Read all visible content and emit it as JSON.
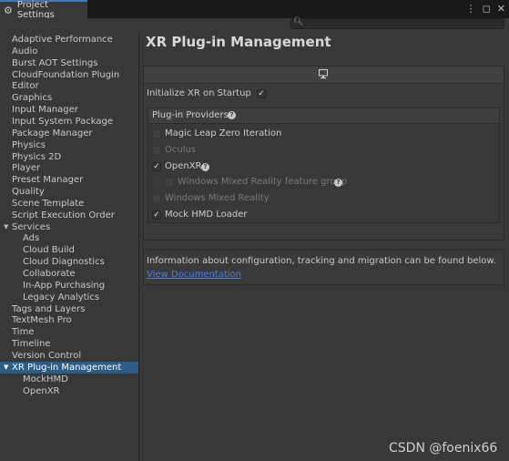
{
  "window": {
    "tab_title": "Project Settings",
    "tab_icon": "gear-icon",
    "controls": [
      "kebab-menu-icon",
      "maximize-icon",
      "close-icon"
    ]
  },
  "search": {
    "placeholder": "",
    "value": ""
  },
  "sidebar": {
    "items": [
      {
        "label": "Adaptive Performance",
        "level": 0
      },
      {
        "label": "Audio",
        "level": 0
      },
      {
        "label": "Burst AOT Settings",
        "level": 0
      },
      {
        "label": "CloudFoundation Plugin",
        "level": 0
      },
      {
        "label": "Editor",
        "level": 0
      },
      {
        "label": "Graphics",
        "level": 0
      },
      {
        "label": "Input Manager",
        "level": 0
      },
      {
        "label": "Input System Package",
        "level": 0
      },
      {
        "label": "Package Manager",
        "level": 0
      },
      {
        "label": "Physics",
        "level": 0
      },
      {
        "label": "Physics 2D",
        "level": 0
      },
      {
        "label": "Player",
        "level": 0
      },
      {
        "label": "Preset Manager",
        "level": 0
      },
      {
        "label": "Quality",
        "level": 0
      },
      {
        "label": "Scene Template",
        "level": 0
      },
      {
        "label": "Script Execution Order",
        "level": 0
      },
      {
        "label": "Services",
        "level": 0,
        "expanded": true
      },
      {
        "label": "Ads",
        "level": 1
      },
      {
        "label": "Cloud Build",
        "level": 1
      },
      {
        "label": "Cloud Diagnostics",
        "level": 1
      },
      {
        "label": "Collaborate",
        "level": 1
      },
      {
        "label": "In-App Purchasing",
        "level": 1
      },
      {
        "label": "Legacy Analytics",
        "level": 1
      },
      {
        "label": "Tags and Layers",
        "level": 0
      },
      {
        "label": "TextMesh Pro",
        "level": 0
      },
      {
        "label": "Time",
        "level": 0
      },
      {
        "label": "Timeline",
        "level": 0
      },
      {
        "label": "Version Control",
        "level": 0
      },
      {
        "label": "XR Plug-in Management",
        "level": 0,
        "expanded": true,
        "selected": true
      },
      {
        "label": "MockHMD",
        "level": 1
      },
      {
        "label": "OpenXR",
        "level": 1
      }
    ]
  },
  "main": {
    "title": "XR Plug-in Management",
    "platform_icon": "desktop-monitor-icon",
    "initialize_label": "Initialize XR on Startup",
    "initialize_checked": true,
    "providers_header": "Plug-in Providers",
    "providers": [
      {
        "label": "Magic Leap Zero Iteration",
        "checked": false,
        "enabled": true,
        "help": false
      },
      {
        "label": "Oculus",
        "checked": false,
        "enabled": false,
        "help": false
      },
      {
        "label": "OpenXR",
        "checked": true,
        "enabled": true,
        "help": true
      },
      {
        "label": "Windows Mixed Reality feature group",
        "checked": false,
        "enabled": false,
        "help": true,
        "indent": true
      },
      {
        "label": "Windows Mixed Reality",
        "checked": false,
        "enabled": false,
        "help": false
      },
      {
        "label": "Mock HMD Loader",
        "checked": true,
        "enabled": true,
        "help": false
      }
    ],
    "info_text": "Information about configuration, tracking and migration can be found below.",
    "doc_link": "View Documentation"
  },
  "watermark": "CSDN @foenix66",
  "colors": {
    "selection": "#2c5d87",
    "link": "#4c7ee4",
    "tab_accent": "#3a79bb",
    "background": "#383838"
  }
}
